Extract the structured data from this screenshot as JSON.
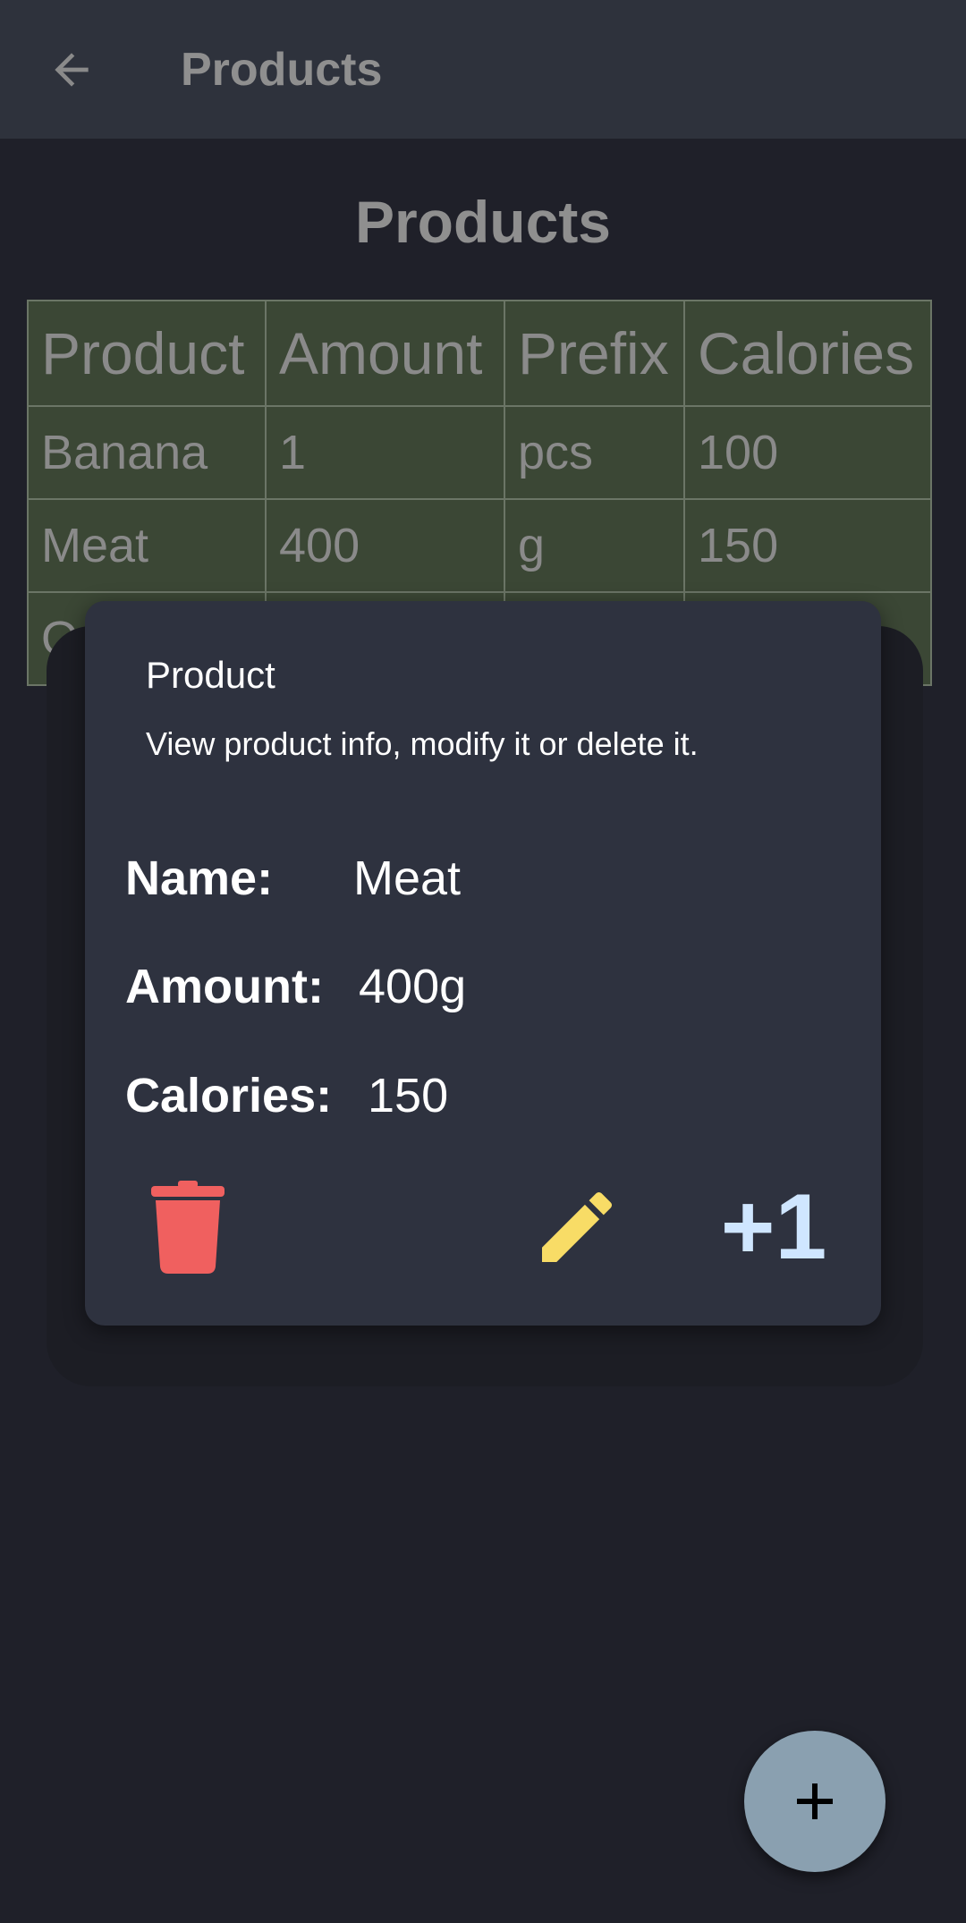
{
  "appbar": {
    "title": "Products",
    "back_icon": "arrow-left-icon"
  },
  "page": {
    "heading": "Products"
  },
  "table": {
    "headers": [
      "Product",
      "Amount",
      "Prefix",
      "Calories"
    ],
    "rows": [
      [
        "Banana",
        "1",
        "pcs",
        "100"
      ],
      [
        "Meat",
        "400",
        "g",
        "150"
      ],
      [
        "Oa",
        "",
        "",
        ""
      ]
    ]
  },
  "dialog": {
    "title": "Product",
    "subtitle": "View product info, modify it or delete it.",
    "name_label": "Name:",
    "name_value": "Meat",
    "amount_label": "Amount:",
    "amount_value": "400g",
    "calories_label": "Calories:",
    "calories_value": "150",
    "delete_icon": "trash-icon",
    "edit_icon": "pencil-icon",
    "increment_label": "+1"
  },
  "fab": {
    "icon": "plus-icon"
  },
  "colors": {
    "background": "#1f2029",
    "appbar": "#2e323c",
    "table_bg": "#3b4735",
    "dialog_bg": "#2e323f",
    "delete_red": "#f0605f",
    "edit_yellow": "#f8dc66",
    "increment_blue": "#cfe6ff",
    "fab": "#8aa0b0"
  }
}
